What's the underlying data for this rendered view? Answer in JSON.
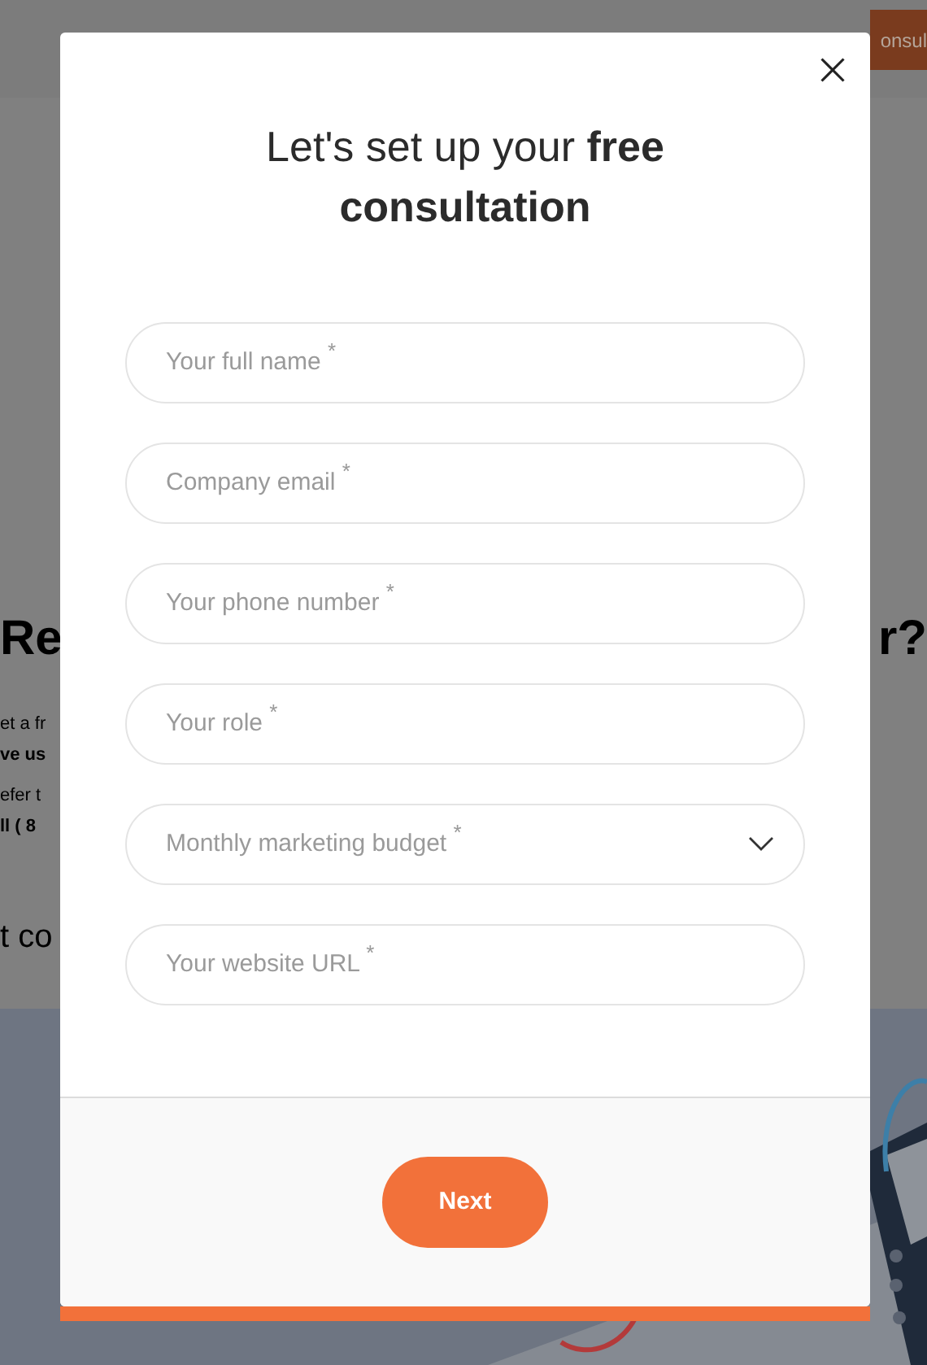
{
  "background": {
    "header_button": "onsul",
    "left_fragments": [
      {
        "text": "Re",
        "kind": "heading"
      },
      {
        "text": "et a fr",
        "kind": "line"
      },
      {
        "text": "ve us",
        "kind": "bold"
      },
      {
        "text": "efer t",
        "kind": "line"
      },
      {
        "text": "ll ( 8",
        "kind": "bold"
      },
      {
        "text": "t co",
        "kind": "subheading"
      }
    ],
    "right_fragments": [
      {
        "text": "r?",
        "kind": "heading"
      }
    ]
  },
  "modal": {
    "title": "Let's set up your **free consultation**",
    "fields": [
      {
        "placeholder": "Your full name",
        "required_mark": "*",
        "kind": "text"
      },
      {
        "placeholder": "Company email",
        "required_mark": "*",
        "kind": "text"
      },
      {
        "placeholder": "Your phone number",
        "required_mark": "*",
        "kind": "text"
      },
      {
        "placeholder": "Your role",
        "required_mark": "*",
        "kind": "text"
      },
      {
        "placeholder": "Monthly marketing budget",
        "required_mark": "*",
        "kind": "select"
      },
      {
        "placeholder": "Your website URL",
        "required_mark": "*",
        "kind": "text"
      }
    ],
    "next_button": "Next"
  }
}
